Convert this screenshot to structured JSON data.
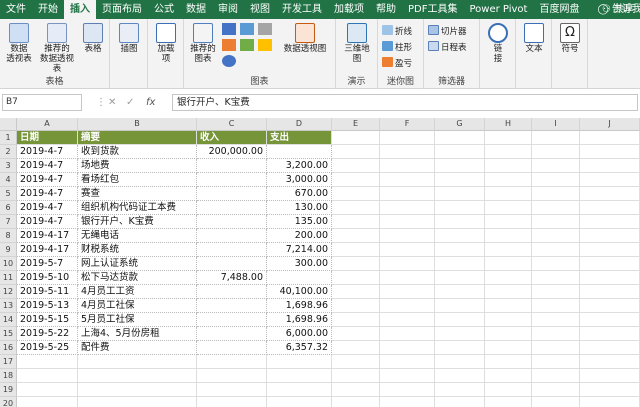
{
  "tabs": [
    "文件",
    "开始",
    "插入",
    "页面布局",
    "公式",
    "数据",
    "审阅",
    "视图",
    "开发工具",
    "加载项",
    "帮助",
    "PDF工具集",
    "Power Pivot",
    "百度网盘"
  ],
  "active_tab": 2,
  "tell_me": "告诉我",
  "share": "共享",
  "ribbon": {
    "tables": {
      "pivot": "数据\n透视表",
      "recommended_pivot": "推荐的\n数据透视表",
      "table": "表格",
      "group": "表格"
    },
    "illustrations": {
      "label": "插图"
    },
    "addins": {
      "label": "加载\n项"
    },
    "charts": {
      "recommended": "推荐的\n图表",
      "pivot_chart": "数据透视图",
      "group": "图表"
    },
    "tours": {
      "map3d": "三维地\n图",
      "group": "演示"
    },
    "sparklines": {
      "line": "折线",
      "column": "柱形",
      "winloss": "盈亏",
      "group": "迷你图"
    },
    "filters": {
      "slicer": "切片器",
      "timeline": "日程表",
      "group": "筛选器"
    },
    "links": {
      "link": "链\n接"
    },
    "text": {
      "label": "文本"
    },
    "symbols": {
      "label": "符号"
    }
  },
  "namebox": "B7",
  "formula": "银行开户、K宝费",
  "columns": [
    "A",
    "B",
    "C",
    "D",
    "E",
    "F",
    "G",
    "H",
    "I",
    "J"
  ],
  "header": {
    "date": "日期",
    "summary": "摘要",
    "income": "收入",
    "expense": "支出"
  },
  "rows": [
    {
      "date": "2019-4-7",
      "summary": "收到货款",
      "income": "200,000.00",
      "expense": ""
    },
    {
      "date": "2019-4-7",
      "summary": "场地费",
      "income": "",
      "expense": "3,200.00"
    },
    {
      "date": "2019-4-7",
      "summary": "看场红包",
      "income": "",
      "expense": "3,000.00"
    },
    {
      "date": "2019-4-7",
      "summary": "赛查",
      "income": "",
      "expense": "670.00"
    },
    {
      "date": "2019-4-7",
      "summary": "组织机构代码证工本费",
      "income": "",
      "expense": "130.00"
    },
    {
      "date": "2019-4-7",
      "summary": "银行开户、K宝费",
      "income": "",
      "expense": "135.00"
    },
    {
      "date": "2019-4-17",
      "summary": "无绳电话",
      "income": "",
      "expense": "200.00"
    },
    {
      "date": "2019-4-17",
      "summary": "财税系统",
      "income": "",
      "expense": "7,214.00"
    },
    {
      "date": "2019-5-7",
      "summary": "网上认证系统",
      "income": "",
      "expense": "300.00"
    },
    {
      "date": "2019-5-10",
      "summary": "松下马达货款",
      "income": "7,488.00",
      "expense": ""
    },
    {
      "date": "2019-5-11",
      "summary": "4月员工工资",
      "income": "",
      "expense": "40,100.00"
    },
    {
      "date": "2019-5-13",
      "summary": "4月员工社保",
      "income": "",
      "expense": "1,698.96"
    },
    {
      "date": "2019-5-15",
      "summary": "5月员工社保",
      "income": "",
      "expense": "1,698.96"
    },
    {
      "date": "2019-5-22",
      "summary": "上海4、5月份房租",
      "income": "",
      "expense": "6,000.00"
    },
    {
      "date": "2019-5-25",
      "summary": "配件费",
      "income": "",
      "expense": "6,357.32"
    }
  ],
  "colors": {
    "accent": "#217346",
    "header_fill": "#769539"
  }
}
